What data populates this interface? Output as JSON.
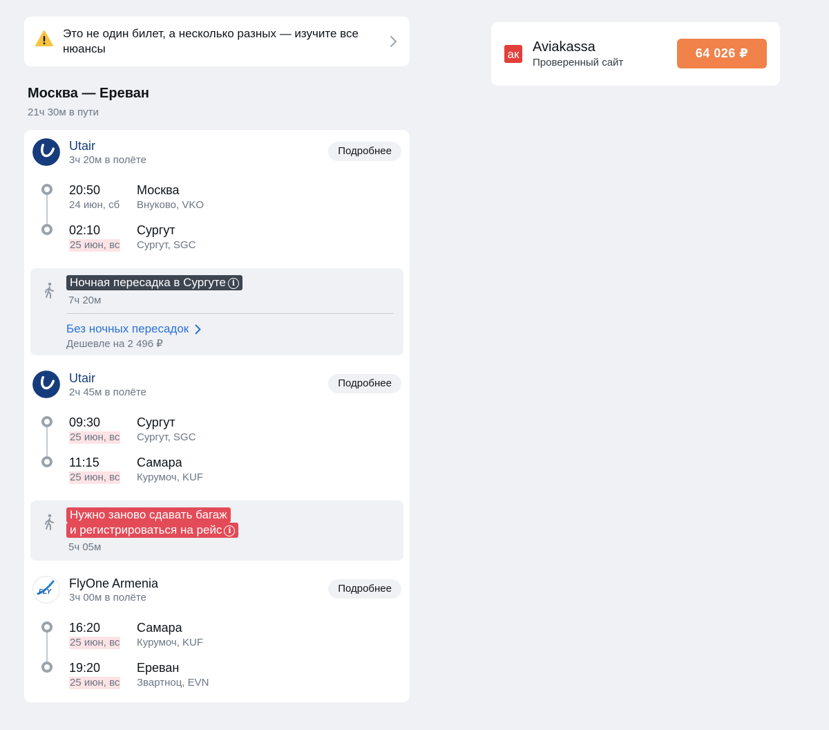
{
  "warning": {
    "text": "Это не один билет, а несколько разных — изучите все нюансы",
    "icon": "warning-triangle-icon"
  },
  "route": {
    "title": "Москва — Ереван",
    "total_duration": "21ч 30м в пути"
  },
  "segments": [
    {
      "airline": "Utair",
      "duration": "3ч 20м в полёте",
      "details_label": "Подробнее",
      "dep_time": "20:50",
      "dep_date": "24 июн, сб",
      "dep_city": "Москва",
      "dep_airport": "Внуково, VKO",
      "arr_time": "02:10",
      "arr_date": "25 июн, вс",
      "arr_city": "Сургут",
      "arr_airport": "Сургут, SGC"
    },
    {
      "airline": "Utair",
      "duration": "2ч 45м в полёте",
      "details_label": "Подробнее",
      "dep_time": "09:30",
      "dep_date": "25 июн, вс",
      "dep_city": "Сургут",
      "dep_airport": "Сургут, SGC",
      "arr_time": "11:15",
      "arr_date": "25 июн, вс",
      "arr_city": "Самара",
      "arr_airport": "Курумоч, KUF"
    },
    {
      "airline": "FlyOne Armenia",
      "duration": "3ч 00м в полёте",
      "details_label": "Подробнее",
      "dep_time": "16:20",
      "dep_date": "25 июн, вс",
      "dep_city": "Самара",
      "dep_airport": "Курумоч, KUF",
      "arr_time": "19:20",
      "arr_date": "25 июн, вс",
      "arr_city": "Ереван",
      "arr_airport": "Звартноц, EVN"
    }
  ],
  "transfers": [
    {
      "tag": "Ночная пересадка в Сургуте",
      "duration": "7ч 20м",
      "alt_link": "Без ночных пересадок",
      "alt_sub": "Дешевле на 2 496 ₽"
    },
    {
      "tag_line1": "Нужно заново сдавать багаж",
      "tag_line2": "и регистрироваться на рейс",
      "duration": "5ч 05м"
    }
  ],
  "offer": {
    "agency": "Aviakassa",
    "agency_sub": "Проверенный сайт",
    "logo_text": "ак",
    "price": "64 026 ₽"
  },
  "logos": {
    "utair_letter": "U",
    "flyone_text": "FLY"
  },
  "colors": {
    "accent_price": "#f0824a",
    "link": "#2a72d5",
    "warning_tag": "#e24b57",
    "night_tag": "#3d4550",
    "utair": "#173c7c"
  }
}
